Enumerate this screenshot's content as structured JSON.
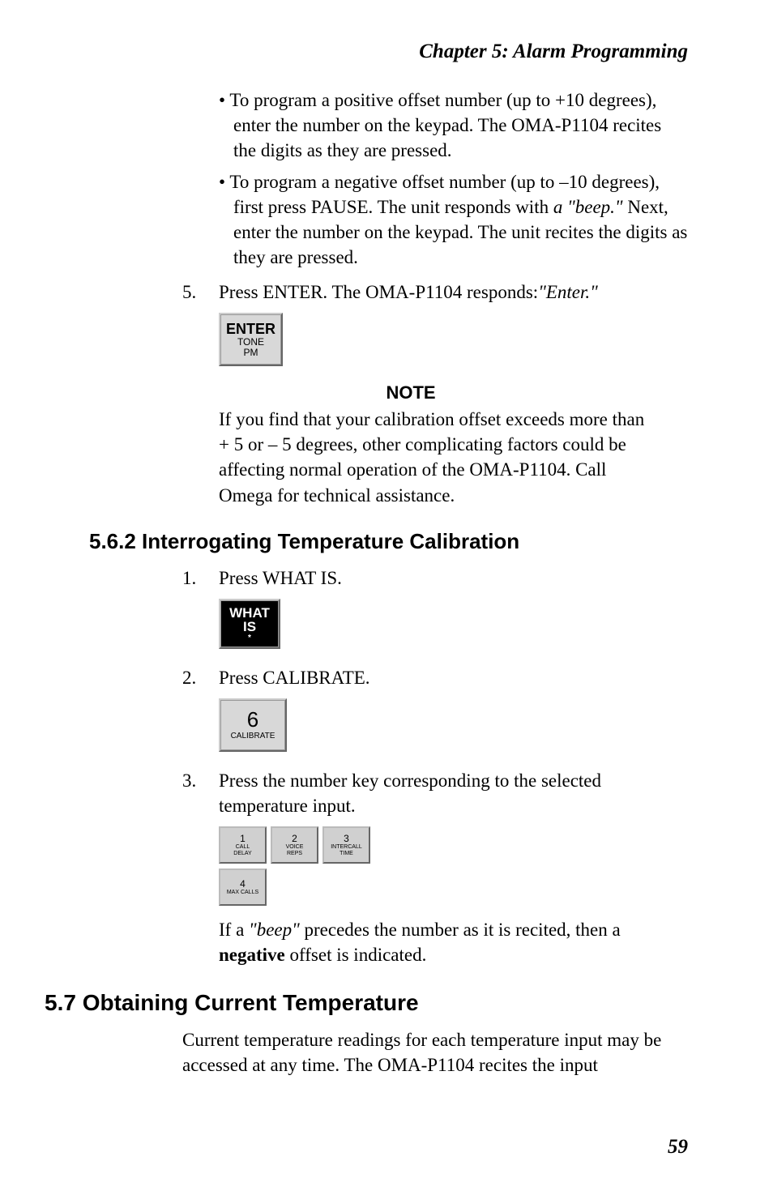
{
  "header": {
    "chapter": "Chapter  5:  Alarm Programming"
  },
  "bullets": [
    {
      "text": "To program a positive offset number (up to +10 degrees), enter the number on the keypad. The OMA-P1104 recites the digits as they are pressed."
    },
    {
      "prefix": "To program a negative offset number (up to –10 degrees), first press PAUSE. The unit responds with ",
      "italic": "a \"beep.\"",
      "suffix": " Next, enter the number on the keypad. The unit recites the digits as they are pressed."
    }
  ],
  "step5": {
    "num": "5.",
    "pre": "Press ENTER. The OMA-P1104 responds:",
    "italic": "\"Enter.\""
  },
  "enterKey": {
    "l1": "ENTER",
    "l2": "TONE",
    "l3": "PM"
  },
  "note": {
    "heading": "NOTE",
    "body": "If you find that your calibration offset exceeds more than + 5 or – 5 degrees, other complicating factors could be affecting normal operation of the OMA-P1104. Call Omega for technical assistance."
  },
  "sec562": {
    "heading": "5.6.2  Interrogating Temperature Calibration",
    "step1": {
      "num": "1.",
      "text": "Press WHAT IS."
    },
    "whatKey": {
      "l1": "WHAT",
      "l2": "IS",
      "l3": "*"
    },
    "step2": {
      "num": "2.",
      "text": "Press CALIBRATE."
    },
    "calKey": {
      "l1": "6",
      "l2": "CALIBRATE"
    },
    "step3": {
      "num": "3.",
      "text": "Press the number key corresponding to the selected temperature input."
    },
    "numkeys": [
      {
        "n": "1",
        "a": "CALL",
        "b": "DELAY"
      },
      {
        "n": "2",
        "a": "VOICE",
        "b": "REPS"
      },
      {
        "n": "3",
        "a": "INTERCALL",
        "b": "TIME"
      },
      {
        "n": "4",
        "a": "MAX CALLS",
        "b": ""
      }
    ],
    "afterKeys": {
      "pre": "If a ",
      "italic": "\"beep\"",
      "mid": " precedes the number as it is recited, then a ",
      "bold": "negative",
      "post": " offset is indicated."
    }
  },
  "sec57": {
    "heading": "5.7  Obtaining Current Temperature",
    "body": "Current temperature readings for each temperature input may be accessed at any time. The OMA-P1104 recites the input"
  },
  "pageNumber": "59"
}
